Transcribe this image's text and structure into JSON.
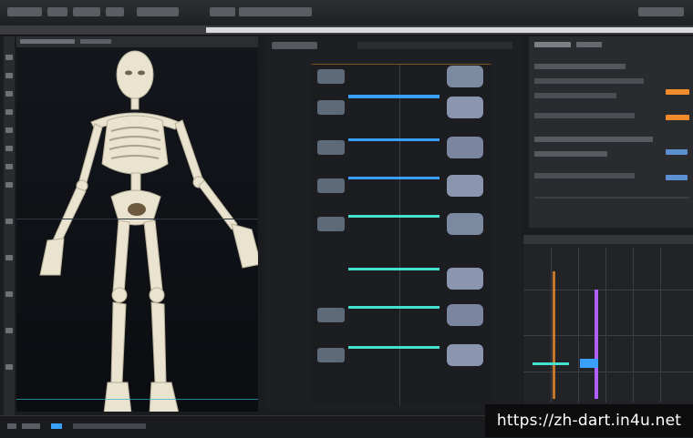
{
  "window": {
    "title": "",
    "panel_viewport_label": "",
    "panel_graph_label": ""
  },
  "watermark": {
    "url": "https://zh-dart.in4u.net"
  },
  "colors": {
    "accent_blue": "#3aa0ff",
    "accent_orange": "#f08a2a",
    "accent_purple": "#b060ff",
    "accent_teal": "#45e0d0"
  },
  "icons": [
    "skeleton-model",
    "node-graph",
    "timeline",
    "toolbar"
  ],
  "graph_nodes": [
    {
      "id": "n1"
    },
    {
      "id": "n2"
    },
    {
      "id": "n3"
    },
    {
      "id": "n4"
    },
    {
      "id": "n5"
    },
    {
      "id": "n6"
    },
    {
      "id": "n7"
    },
    {
      "id": "n8"
    }
  ]
}
